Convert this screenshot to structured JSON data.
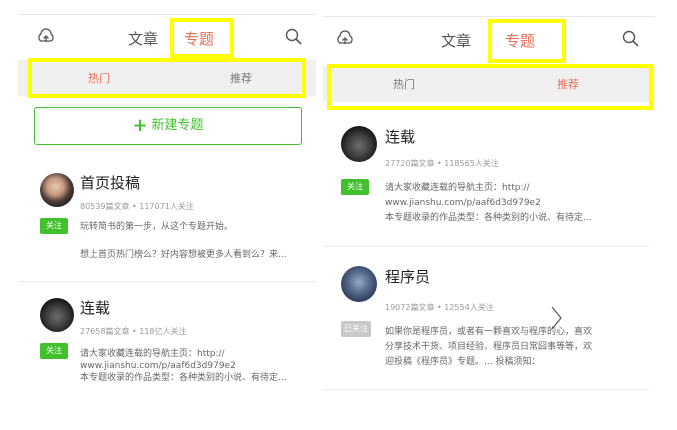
{
  "left": {
    "nav": {
      "article": "文章",
      "topic": "专题"
    },
    "subtabs": {
      "hot": "热门",
      "recommend": "推荐"
    },
    "new_topic": "新建专题",
    "items": [
      {
        "title": "首页投稿",
        "meta": "80539篇文章 • 117071人关注",
        "follow": "关注",
        "desc1": "玩转简书的第一步，从这个专题开始。",
        "desc2": "想上首页热门榜么？好内容想被更多人看到么？来..."
      },
      {
        "title": "连载",
        "meta": "27658篇文章 • 118亿人关注",
        "follow": "关注",
        "desc1": "请大家收藏连载的导航主页：http://",
        "desc2": "www.jianshu.com/p/aaf6d3d979e2",
        "desc3": "本专题收录的作品类型：各种类别的小说、有待定..."
      }
    ]
  },
  "right": {
    "nav": {
      "article": "文章",
      "topic": "专题"
    },
    "subtabs": {
      "hot": "热门",
      "recommend": "推荐"
    },
    "items": [
      {
        "title": "连载",
        "meta": "27720篇文章 • 118565人关注",
        "follow": "关注",
        "desc1": "请大家收藏连载的导航主页：http://",
        "desc2": "www.jianshu.com/p/aaf6d3d979e2",
        "desc3": "本专题收录的作品类型：各种类别的小说、有待定..."
      },
      {
        "title": "程序员",
        "meta": "19072篇文章 • 12554人关注",
        "follow": "已关注",
        "desc1": "如果你是程序员，或者有一颗喜欢与程序的心，喜欢",
        "desc2": "分享技术干货、项目经验、程序员日常囧事等等，欢",
        "desc3": "迎投稿《程序员》专题。... 投稿须知："
      }
    ]
  }
}
